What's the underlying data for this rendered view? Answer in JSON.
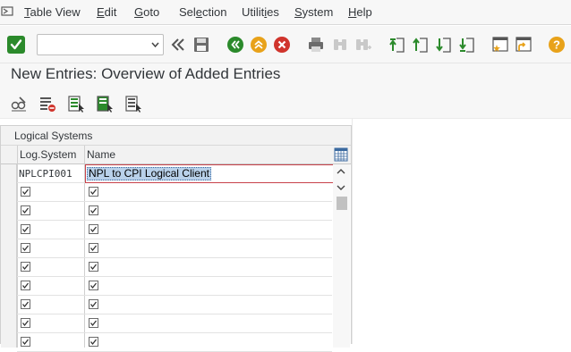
{
  "menubar": {
    "items": [
      {
        "pre": "",
        "ul": "T",
        "post": "able View"
      },
      {
        "pre": "",
        "ul": "E",
        "post": "dit"
      },
      {
        "pre": "",
        "ul": "G",
        "post": "oto"
      },
      {
        "pre": "Sel",
        "ul": "e",
        "post": "ction"
      },
      {
        "pre": "Utilit",
        "ul": "i",
        "post": "es"
      },
      {
        "pre": "",
        "ul": "S",
        "post": "ystem"
      },
      {
        "pre": "",
        "ul": "H",
        "post": "elp"
      }
    ]
  },
  "toolbar": {
    "command_value": "",
    "icons": [
      "enter-icon",
      "back-arrows-icon",
      "save-icon",
      "back-icon",
      "exit-icon",
      "cancel-icon",
      "print-icon",
      "find-icon",
      "find-next-icon",
      "first-page-icon",
      "previous-page-icon",
      "next-page-icon",
      "last-page-icon",
      "create-session-icon",
      "create-shortcut-icon",
      "help-icon"
    ]
  },
  "page": {
    "title": "New Entries: Overview of Added Entries"
  },
  "app_toolbar": {
    "icons": [
      "display-change-icon",
      "delete-icon",
      "select-all-icon",
      "select-block-icon",
      "deselect-all-icon"
    ]
  },
  "table": {
    "title": "Logical Systems",
    "columns": [
      "Log.System",
      "Name"
    ],
    "rows": [
      {
        "log_system": "NPLCPI001",
        "name": "NPL to CPI Logical Client",
        "editing": true
      },
      {
        "log_system": "",
        "name": "",
        "editing": false
      },
      {
        "log_system": "",
        "name": "",
        "editing": false
      },
      {
        "log_system": "",
        "name": "",
        "editing": false
      },
      {
        "log_system": "",
        "name": "",
        "editing": false
      },
      {
        "log_system": "",
        "name": "",
        "editing": false
      },
      {
        "log_system": "",
        "name": "",
        "editing": false
      },
      {
        "log_system": "",
        "name": "",
        "editing": false
      },
      {
        "log_system": "",
        "name": "",
        "editing": false
      },
      {
        "log_system": "",
        "name": "",
        "editing": false
      }
    ]
  },
  "colors": {
    "green": "#2b8a2b",
    "orange": "#e8a21a",
    "red": "#d0342c",
    "error_border": "#c8424a",
    "selection": "#b9d1ea"
  }
}
